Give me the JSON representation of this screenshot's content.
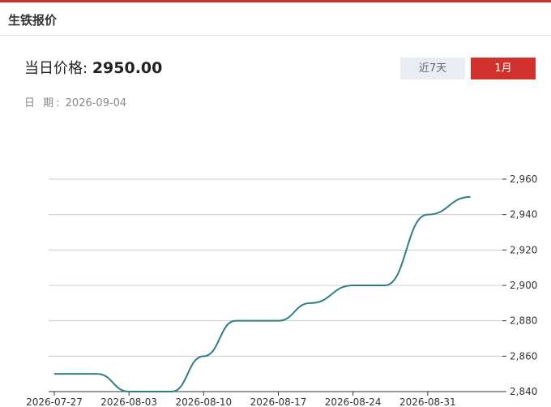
{
  "header": {
    "title": "生铁报价"
  },
  "price": {
    "label": "当日价格:",
    "value": "2950.00"
  },
  "date": {
    "label": "日 期:",
    "value": "2026-09-04"
  },
  "tabs": [
    {
      "label": "近7天",
      "active": false
    },
    {
      "label": "1月",
      "active": true
    }
  ],
  "colors": {
    "accent": "#d0312d",
    "line": "#2e7f84",
    "grid": "#cccccc"
  },
  "chart_data": {
    "type": "line",
    "title": "",
    "xlabel": "",
    "ylabel": "",
    "x": [
      "2026-07-27",
      "2026-07-31",
      "2026-08-03",
      "2026-08-07",
      "2026-08-10",
      "2026-08-13",
      "2026-08-17",
      "2026-08-20",
      "2026-08-24",
      "2026-08-27",
      "2026-08-31",
      "2026-09-04"
    ],
    "series": [
      {
        "values": [
          2850,
          2850,
          2840,
          2840,
          2860,
          2880,
          2880,
          2890,
          2900,
          2900,
          2940,
          2950
        ]
      }
    ],
    "ylim": [
      2840,
      2960
    ],
    "yticks": [
      "2,840",
      "2,860",
      "2,880",
      "2,900",
      "2,920",
      "2,940",
      "2,960"
    ],
    "xticks": [
      "2026-07-27",
      "2026-08-03",
      "2026-08-10",
      "2026-08-17",
      "2026-08-24",
      "2026-08-31"
    ],
    "grid": true,
    "y_axis_side": "right"
  }
}
